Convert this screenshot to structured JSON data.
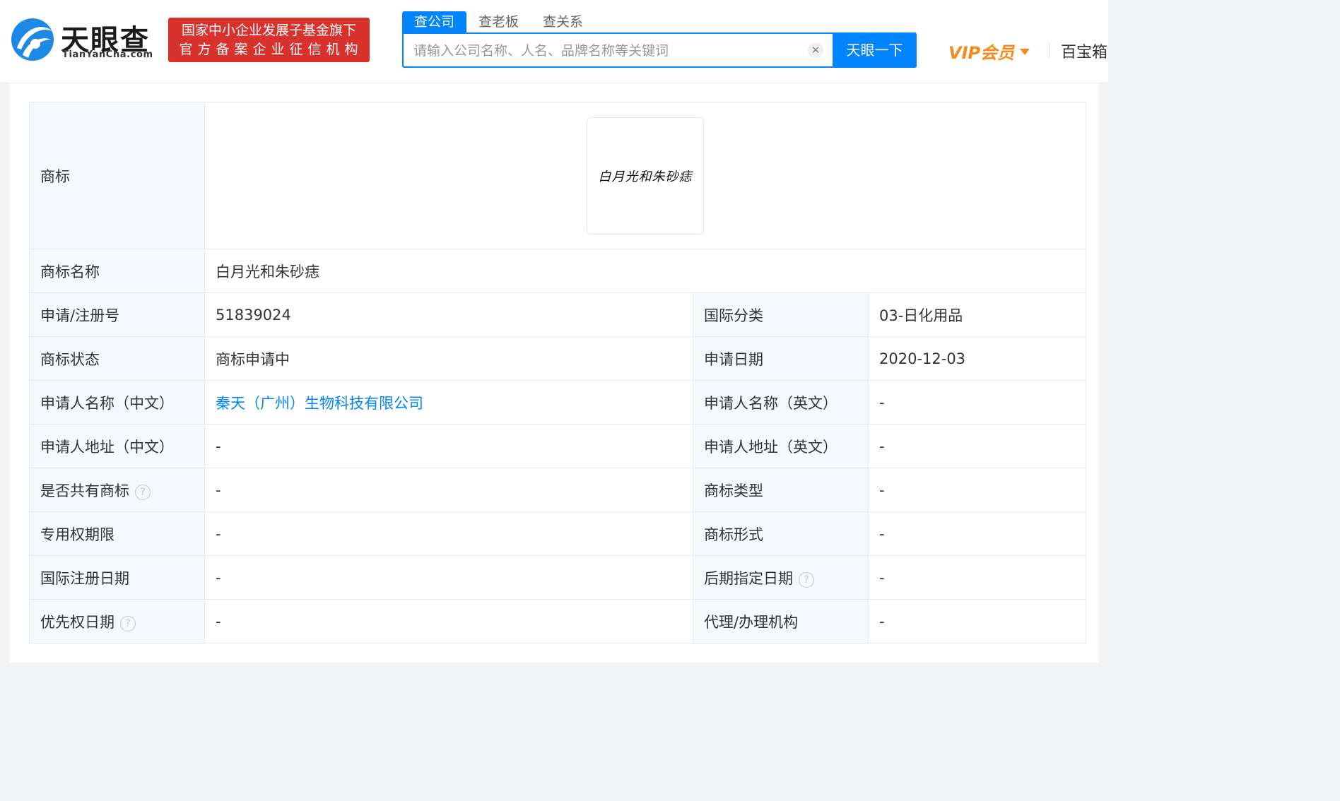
{
  "header": {
    "logo_cn": "天眼查",
    "logo_en": "TianYanCha.com",
    "gov_badge": {
      "line1": "国家中小企业发展子基金旗下",
      "line2": "官方备案企业征信机构"
    },
    "search": {
      "tabs": [
        "查公司",
        "查老板",
        "查关系"
      ],
      "placeholder": "请输入公司名称、人名、品牌名称等关键词",
      "value": "",
      "button": "天眼一下",
      "clear_icon": "close-icon"
    },
    "vip_label": "VIP会员",
    "baobox_label": "百宝箱"
  },
  "trademark": {
    "logo_label": "商标",
    "logo_text": "白月光和朱砂痣",
    "rows": [
      {
        "label": "商标名称",
        "value": "白月光和朱砂痣"
      },
      {
        "label": "申请/注册号",
        "value": "51839024",
        "label2": "国际分类",
        "value2": "03-日化用品"
      },
      {
        "label": "商标状态",
        "value": "商标申请中",
        "label2": "申请日期",
        "value2": "2020-12-03"
      },
      {
        "label": "申请人名称（中文）",
        "value": "秦天（广州）生物科技有限公司",
        "value_is_link": true,
        "label2": "申请人名称（英文）",
        "value2": "-"
      },
      {
        "label": "申请人地址（中文）",
        "value": "-",
        "label2": "申请人地址（英文）",
        "value2": "-"
      },
      {
        "label": "是否共有商标",
        "label_help": true,
        "value": "-",
        "label2": "商标类型",
        "value2": "-"
      },
      {
        "label": "专用权期限",
        "value": "-",
        "label2": "商标形式",
        "value2": "-"
      },
      {
        "label": "国际注册日期",
        "value": "-",
        "label2": "后期指定日期",
        "label2_help": true,
        "value2": "-"
      },
      {
        "label": "优先权日期",
        "label_help": true,
        "value": "-",
        "label2": "代理/办理机构",
        "value2": "-"
      }
    ],
    "help_glyph": "?"
  }
}
